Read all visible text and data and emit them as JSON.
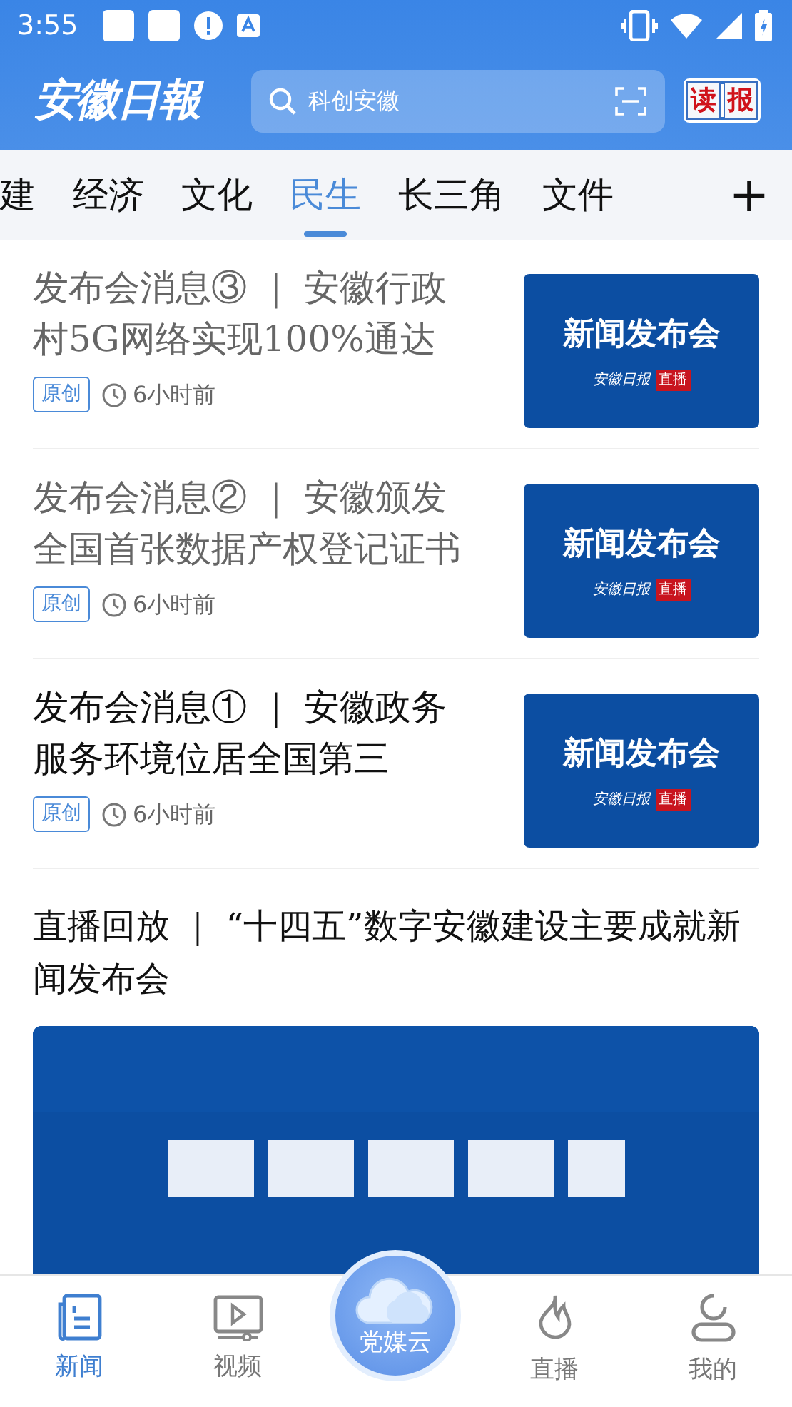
{
  "status_bar": {
    "time": "3:55"
  },
  "header": {
    "logo": "安徽日報",
    "search": {
      "placeholder": "科创安徽"
    },
    "read_paper": [
      "读",
      "报"
    ]
  },
  "tabs": [
    {
      "label": "建",
      "selected": false
    },
    {
      "label": "经济",
      "selected": false
    },
    {
      "label": "文化",
      "selected": false
    },
    {
      "label": "民生",
      "selected": true
    },
    {
      "label": "长三角",
      "selected": false
    },
    {
      "label": "文件",
      "selected": false
    }
  ],
  "add_tab": "+",
  "articles": [
    {
      "title": "发布会消息③ ｜ 安徽行政村5G网络实现100%通达",
      "read": true,
      "tag": "原创",
      "time": "6小时前",
      "thumb": {
        "title": "新闻发布会",
        "brand": "安徽日报",
        "badge": "直播"
      }
    },
    {
      "title": "发布会消息② ｜ 安徽颁发全国首张数据产权登记证书",
      "read": true,
      "tag": "原创",
      "time": "6小时前",
      "thumb": {
        "title": "新闻发布会",
        "brand": "安徽日报",
        "badge": "直播"
      }
    },
    {
      "title": "发布会消息① ｜ 安徽政务服务环境位居全国第三",
      "read": false,
      "tag": "原创",
      "time": "6小时前",
      "thumb": {
        "title": "新闻发布会",
        "brand": "安徽日报",
        "badge": "直播"
      }
    }
  ],
  "feature": {
    "title": "直播回放 ｜ “十四五”数字安徽建设主要成就新闻发布会",
    "kind": "picture"
  },
  "bottom_nav": [
    {
      "label": "新闻",
      "kind": "tab",
      "selected": true
    },
    {
      "label": "视频",
      "kind": "tab",
      "selected": false
    },
    {
      "label": "党媒云",
      "kind": "center",
      "selected": false
    },
    {
      "label": "直播",
      "kind": "tab",
      "selected": false
    },
    {
      "label": "我的",
      "kind": "tab",
      "selected": false
    }
  ]
}
